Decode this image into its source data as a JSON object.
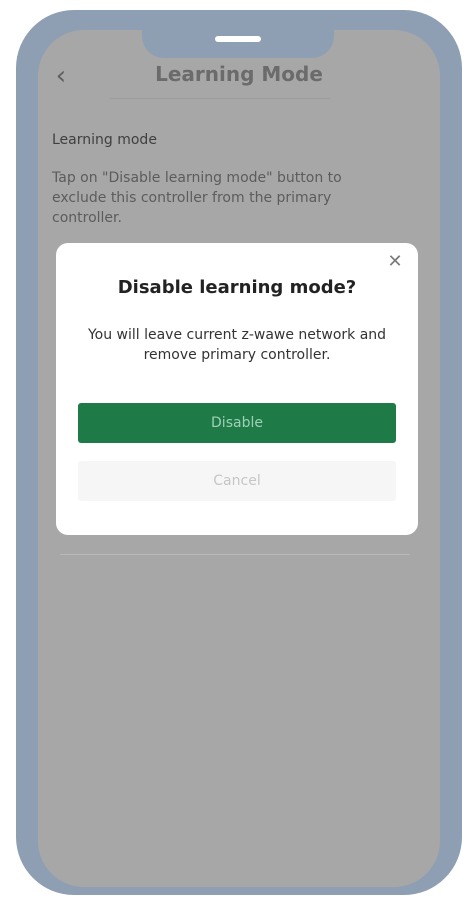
{
  "header": {
    "title": "Learning Mode",
    "back_icon": "chevron-left-icon"
  },
  "content": {
    "heading": "Learning mode",
    "paragraph": "Tap on \"Disable learning mode\" button to exclude this controller from the primary controller."
  },
  "dialog": {
    "title": "Disable learning mode?",
    "message": "You will leave current z-wawe network and remove primary controller.",
    "primary_label": "Disable",
    "secondary_label": "Cancel",
    "close_icon": "close-icon"
  },
  "colors": {
    "primary_button": "#1e7b47",
    "frame": "#8f9fb3",
    "overlay": "#a7a7a7"
  }
}
